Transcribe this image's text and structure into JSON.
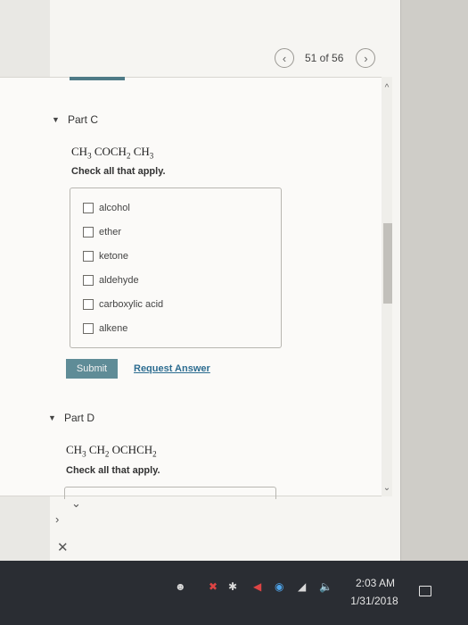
{
  "pager": {
    "prev_icon": "chevron-left-icon",
    "text": "51 of 56",
    "next_icon": "chevron-right-icon"
  },
  "part_c": {
    "label": "Part C",
    "formula": [
      "CH",
      "3",
      " COCH",
      "2",
      " CH",
      "3"
    ],
    "instruction": "Check all that apply.",
    "options": [
      "alcohol",
      "ether",
      "ketone",
      "aldehyde",
      "carboxylic acid",
      "alkene"
    ],
    "submit_label": "Submit",
    "request_label": "Request Answer"
  },
  "part_d": {
    "label": "Part D",
    "formula": [
      "CH",
      "3",
      " CH",
      "2",
      " OCHCH",
      "2"
    ],
    "instruction": "Check all that apply."
  },
  "taskbar": {
    "time": "2:03 AM",
    "date": "1/31/2018"
  },
  "colors": {
    "accent": "#5f8c97",
    "link": "#2c6c90",
    "taskbar": "#2a2d33"
  }
}
